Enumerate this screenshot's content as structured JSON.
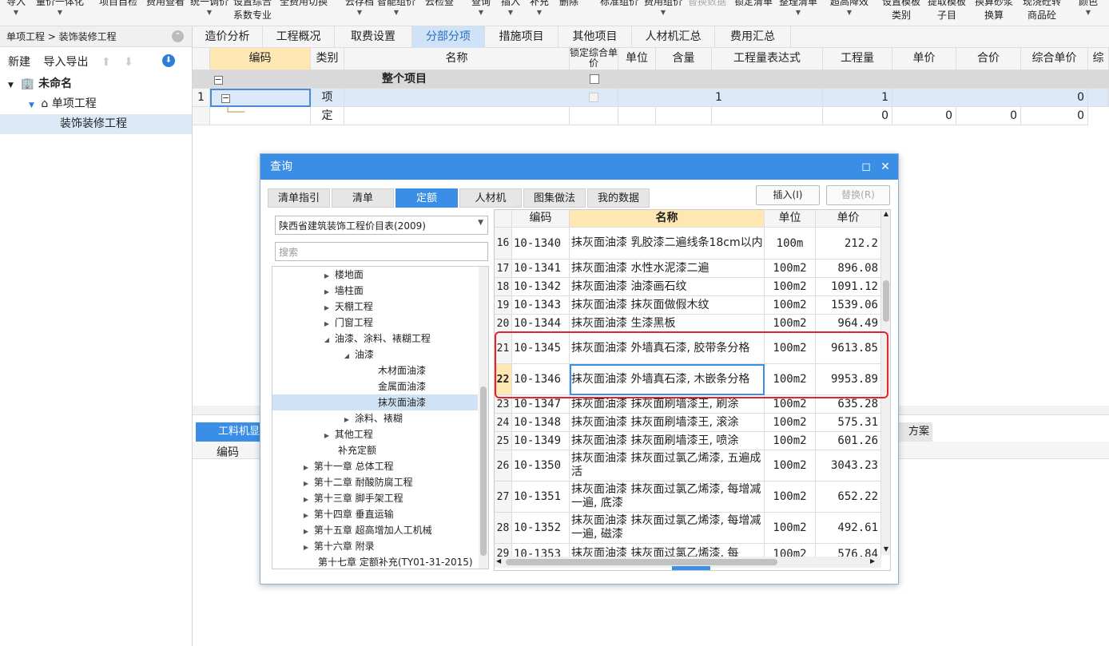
{
  "ribbon": {
    "items": [
      "导入",
      "量价一体化",
      "项目自检",
      "费用查看",
      "统一调价",
      "设置综合",
      "全费用切换",
      "云存档",
      "智能组价",
      "云检查",
      "查询",
      "插入",
      "补充",
      "删除",
      "标准组价",
      "费用组价",
      "替换数据",
      "锁定清单",
      "整理清单",
      "超高降效",
      "设置模板",
      "提取模板",
      "换算砂浆",
      "现浇砼转",
      "颜色"
    ],
    "sub": [
      "系数专业",
      "类别",
      "子目",
      "换算",
      "商品砼"
    ]
  },
  "left": {
    "breadcrumb": "单项工程 > 装饰装修工程",
    "new_label": "新建",
    "import_label": "导入导出",
    "tree": [
      "未命名",
      "单项工程",
      "装饰装修工程"
    ]
  },
  "tabs": [
    "造价分析",
    "工程概况",
    "取费设置",
    "分部分项",
    "措施项目",
    "其他项目",
    "人材机汇总",
    "费用汇总"
  ],
  "grid": {
    "headers": [
      "编码",
      "类别",
      "名称",
      "锁定综合单价",
      "单位",
      "含量",
      "工程量表达式",
      "工程量",
      "单价",
      "合价",
      "综合单价",
      "综"
    ],
    "whole": "整个项目",
    "row1": {
      "num": "1",
      "type": "项",
      "expr": "1",
      "qty": "1",
      "total": "0"
    },
    "row2": {
      "type": "定",
      "qty": "0",
      "price": "0",
      "amount": "0",
      "total": "0"
    }
  },
  "bottom": {
    "tab": "工料机显示",
    "code_label": "编码",
    "right_tab": "方案"
  },
  "dialog": {
    "title": "查询",
    "tabs": [
      "清单指引",
      "清单",
      "定额",
      "人材机",
      "图集做法",
      "我的数据"
    ],
    "insert": "插入(I)",
    "replace": "替换(R)",
    "library": "陕西省建筑装饰工程价目表(2009)",
    "search_placeholder": "搜索",
    "tree": [
      "楼地面",
      "墙柱面",
      "天棚工程",
      "门窗工程",
      "油漆、涂料、裱糊工程",
      "油漆",
      "木材面油漆",
      "金属面油漆",
      "抹灰面油漆",
      "涂料、裱糊",
      "其他工程",
      "补充定额",
      "第十一章 总体工程",
      "第十二章 耐酸防腐工程",
      "第十三章 脚手架工程",
      "第十四章 垂直运输",
      "第十五章 超高增加人工机械",
      "第十六章 附录",
      "第十七章 定额补充(TY01-31-2015)"
    ],
    "headers": [
      "编码",
      "名称",
      "单位",
      "单价"
    ],
    "rows": [
      {
        "n": "16",
        "code": "10-1340",
        "name": "抹灰面油漆 乳胶漆二遍线条18cm以内",
        "unit": "100m",
        "price": "212.2"
      },
      {
        "n": "17",
        "code": "10-1341",
        "name": "抹灰面油漆 水性水泥漆二遍",
        "unit": "100m2",
        "price": "896.08"
      },
      {
        "n": "18",
        "code": "10-1342",
        "name": "抹灰面油漆 油漆画石纹",
        "unit": "100m2",
        "price": "1091.12"
      },
      {
        "n": "19",
        "code": "10-1343",
        "name": "抹灰面油漆 抹灰面做假木纹",
        "unit": "100m2",
        "price": "1539.06"
      },
      {
        "n": "20",
        "code": "10-1344",
        "name": "抹灰面油漆 生漆黑板",
        "unit": "100m2",
        "price": "964.49"
      },
      {
        "n": "21",
        "code": "10-1345",
        "name": "抹灰面油漆 外墙真石漆, 胶带条分格",
        "unit": "100m2",
        "price": "9613.85"
      },
      {
        "n": "22",
        "code": "10-1346",
        "name": "抹灰面油漆 外墙真石漆, 木嵌条分格",
        "unit": "100m2",
        "price": "9953.89"
      },
      {
        "n": "23",
        "code": "10-1347",
        "name": "抹灰面油漆 抹灰面刷墙漆王, 刷涂",
        "unit": "100m2",
        "price": "635.28"
      },
      {
        "n": "24",
        "code": "10-1348",
        "name": "抹灰面油漆 抹灰面刷墙漆王, 滚涂",
        "unit": "100m2",
        "price": "575.31"
      },
      {
        "n": "25",
        "code": "10-1349",
        "name": "抹灰面油漆 抹灰面刷墙漆王, 喷涂",
        "unit": "100m2",
        "price": "601.26"
      },
      {
        "n": "26",
        "code": "10-1350",
        "name": "抹灰面油漆 抹灰面过氯乙烯漆, 五遍成活",
        "unit": "100m2",
        "price": "3043.23"
      },
      {
        "n": "27",
        "code": "10-1351",
        "name": "抹灰面油漆 抹灰面过氯乙烯漆, 每增减一遍, 底漆",
        "unit": "100m2",
        "price": "652.22"
      },
      {
        "n": "28",
        "code": "10-1352",
        "name": "抹灰面油漆 抹灰面过氯乙烯漆, 每增减一遍, 磁漆",
        "unit": "100m2",
        "price": "492.61"
      },
      {
        "n": "29",
        "code": "10-1353",
        "name": "抹灰面油漆 抹灰面过氯乙烯漆, 每",
        "unit": "100m2",
        "price": "576.84"
      }
    ]
  }
}
